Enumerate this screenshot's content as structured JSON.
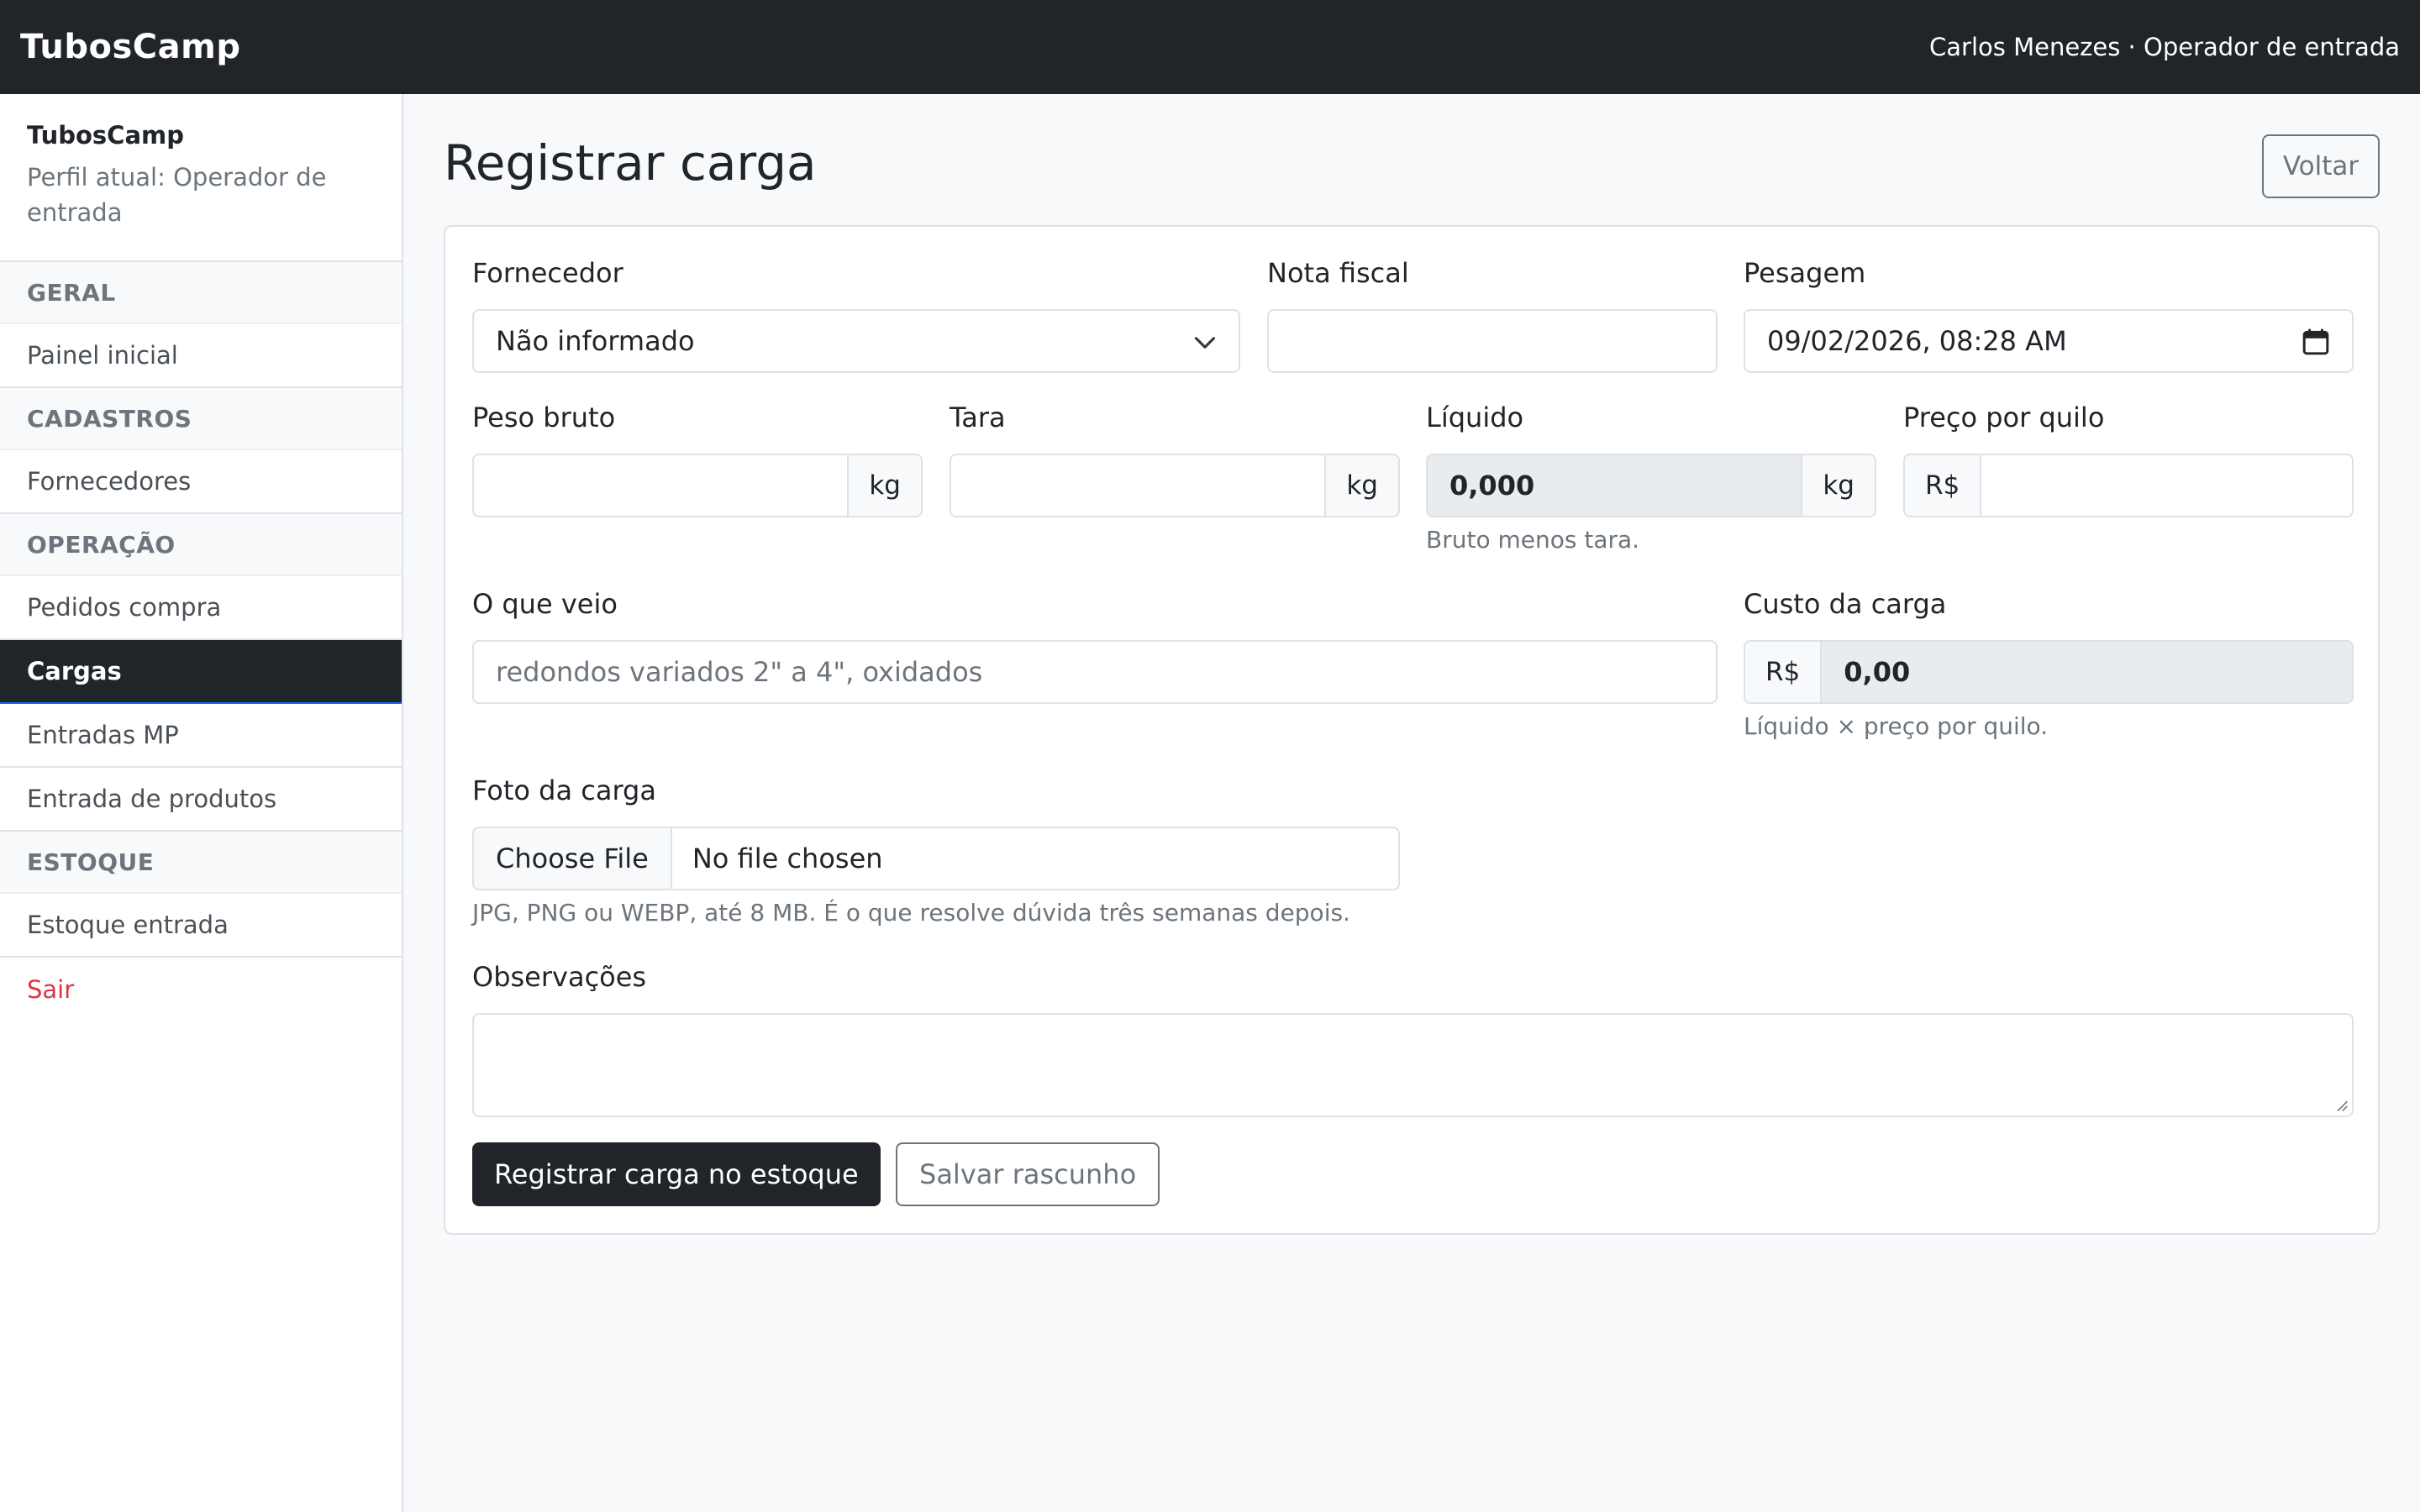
{
  "navbar": {
    "brand": "TubosCamp",
    "user": "Carlos Menezes · Operador de entrada"
  },
  "sidebar": {
    "brand": "TubosCamp",
    "profile": "Perfil atual: Operador de entrada",
    "sections": {
      "geral": "GERAL",
      "cadastros": "CADASTROS",
      "operacao": "OPERAÇÃO",
      "estoque": "ESTOQUE"
    },
    "items": {
      "painel": "Painel inicial",
      "fornecedores": "Fornecedores",
      "pedidos": "Pedidos compra",
      "cargas": "Cargas",
      "entradas_mp": "Entradas MP",
      "entrada_produtos": "Entrada de produtos",
      "estoque_entrada": "Estoque entrada",
      "sair": "Sair"
    },
    "active_item": "Cargas"
  },
  "page": {
    "title": "Registrar carga",
    "back_label": "Voltar"
  },
  "form": {
    "fornecedor": {
      "label": "Fornecedor",
      "value": "Não informado"
    },
    "nota_fiscal": {
      "label": "Nota fiscal",
      "value": ""
    },
    "pesagem": {
      "label": "Pesagem",
      "value": "09/02/2026, 08:28 AM"
    },
    "peso_bruto": {
      "label": "Peso bruto",
      "value": "",
      "unit": "kg"
    },
    "tara": {
      "label": "Tara",
      "value": "",
      "unit": "kg"
    },
    "liquido": {
      "label": "Líquido",
      "value": "0,000",
      "unit": "kg",
      "help": "Bruto menos tara."
    },
    "preco_quilo": {
      "label": "Preço por quilo",
      "prefix": "R$",
      "value": ""
    },
    "o_que_veio": {
      "label": "O que veio",
      "placeholder": "redondos variados 2\" a 4\", oxidados"
    },
    "custo_carga": {
      "label": "Custo da carga",
      "prefix": "R$",
      "value": "0,00",
      "help": "Líquido × preço por quilo."
    },
    "foto": {
      "label": "Foto da carga",
      "button": "Choose File",
      "status": "No file chosen",
      "help": "JPG, PNG ou WEBP, até 8 MB. É o que resolve dúvida três semanas depois."
    },
    "observacoes": {
      "label": "Observações",
      "value": ""
    },
    "submit_label": "Registrar carga no estoque",
    "draft_label": "Salvar rascunho"
  }
}
